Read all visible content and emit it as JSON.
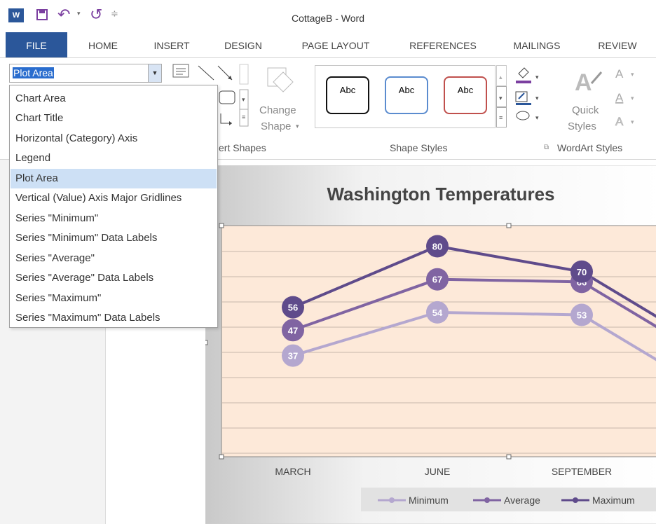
{
  "window": {
    "title": "CottageB - Word",
    "word_icon_label": "W"
  },
  "tabs": [
    {
      "label": "FILE"
    },
    {
      "label": "HOME"
    },
    {
      "label": "INSERT"
    },
    {
      "label": "DESIGN"
    },
    {
      "label": "PAGE LAYOUT"
    },
    {
      "label": "REFERENCES"
    },
    {
      "label": "MAILINGS"
    },
    {
      "label": "REVIEW"
    }
  ],
  "ribbon": {
    "selection_value": "Plot Area",
    "change_shape_1": "Change",
    "change_shape_2": "Shape",
    "insert_shapes_label": "ert Shapes",
    "shape_styles_label": "Shape Styles",
    "abc": "Abc",
    "quick_styles_1": "Quick",
    "quick_styles_2": "Styles",
    "wordart_label": "WordArt Styles"
  },
  "dropdown": {
    "items": [
      "Chart Area",
      "Chart Title",
      "Horizontal (Category) Axis",
      "Legend",
      "Plot Area",
      "Vertical (Value) Axis Major Gridlines",
      "Series \"Minimum\"",
      "Series \"Minimum\" Data Labels",
      "Series \"Average\"",
      "Series \"Average\" Data Labels",
      "Series \"Maximum\"",
      "Series \"Maximum\" Data Labels"
    ],
    "selected": "Plot Area"
  },
  "colors": {
    "accent": "#2b579a",
    "minimum": "#b4a7cf",
    "average": "#8064a2",
    "maximum": "#5f4b8b",
    "plot_bg": "#fde9d9"
  },
  "chart_data": {
    "type": "line",
    "title": "Washington Temperatures",
    "categories": [
      "MARCH",
      "JUNE",
      "SEPTEMBER"
    ],
    "series": [
      {
        "name": "Minimum",
        "values": [
          37,
          54,
          53
        ]
      },
      {
        "name": "Average",
        "values": [
          47,
          67,
          66
        ]
      },
      {
        "name": "Maximum",
        "values": [
          56,
          80,
          70
        ]
      }
    ],
    "legend": "bottom",
    "grid": true
  }
}
